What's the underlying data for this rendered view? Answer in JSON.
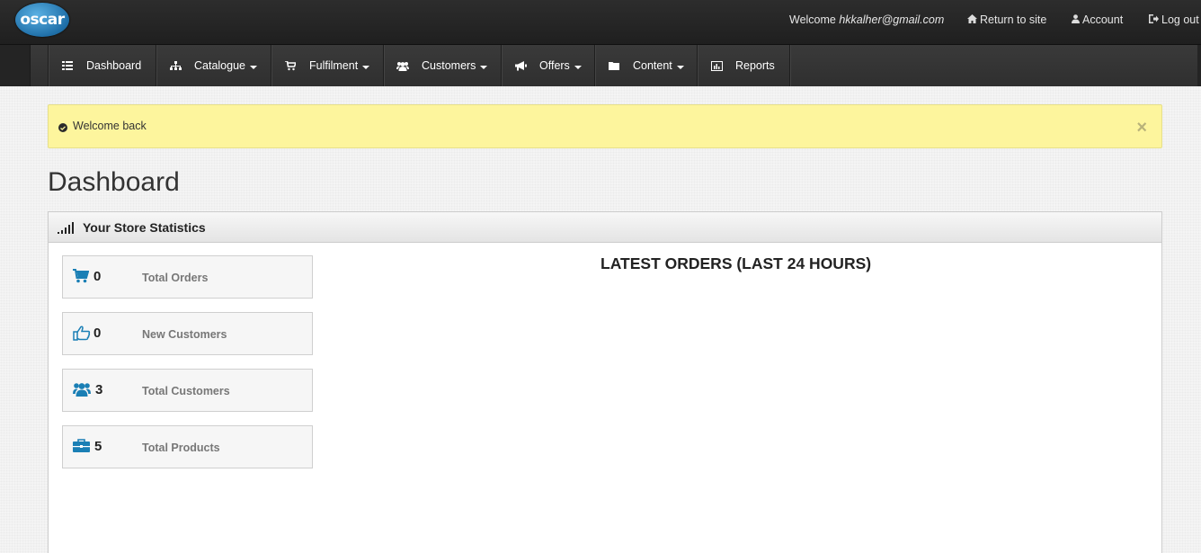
{
  "header": {
    "logo_text": "oscar",
    "welcome_prefix": "Welcome",
    "welcome_email": "hkkalher@gmail.com",
    "return_label": "Return to site",
    "account_label": "Account",
    "logout_label": "Log out"
  },
  "nav": {
    "items": [
      {
        "label": "Dashboard",
        "icon": "list-icon"
      },
      {
        "label": "Catalogue",
        "icon": "sitemap-icon",
        "dropdown": true
      },
      {
        "label": "Fulfilment",
        "icon": "cart-icon",
        "dropdown": true
      },
      {
        "label": "Customers",
        "icon": "group-icon",
        "dropdown": true
      },
      {
        "label": "Offers",
        "icon": "bullhorn-icon",
        "dropdown": true
      },
      {
        "label": "Content",
        "icon": "folder-icon",
        "dropdown": true
      },
      {
        "label": "Reports",
        "icon": "bar-chart-icon"
      }
    ]
  },
  "alert": {
    "message": "Welcome back",
    "close": "×"
  },
  "page": {
    "title": "Dashboard"
  },
  "stats_panel": {
    "title": "Your Store Statistics",
    "stats": [
      {
        "value": "0",
        "label": "Total Orders",
        "icon": "shopping-cart-icon"
      },
      {
        "value": "0",
        "label": "New Customers",
        "icon": "thumbs-up-icon"
      },
      {
        "value": "3",
        "label": "Total Customers",
        "icon": "group-icon"
      },
      {
        "value": "5",
        "label": "Total Products",
        "icon": "briefcase-icon"
      }
    ],
    "latest_orders_title": "LATEST ORDERS (LAST 24 HOURS)"
  },
  "colors": {
    "accent": "#1a7fb5",
    "alert_bg": "#fdf59d",
    "nav_bg": "#333333"
  }
}
